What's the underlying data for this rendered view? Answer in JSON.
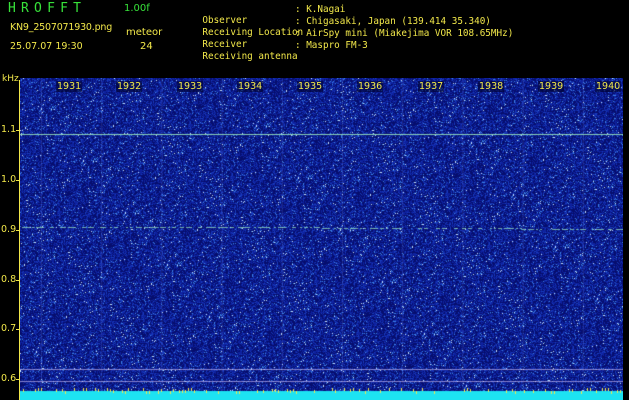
{
  "header": {
    "app_name": "HROFFT",
    "version": "1.00f",
    "filename": "KN9_2507071930.png",
    "unit_label": "meteor",
    "timestamp": "25.07.07 19:30",
    "count": "24",
    "info": [
      {
        "label": "Observer",
        "value": ": K.Nagai"
      },
      {
        "label": "Receiving Location",
        "value": ": Chigasaki, Japan (139.414 35.340)"
      },
      {
        "label": "Receiver",
        "value": ": AirSpy mini (Miakejima VOR 108.65MHz)"
      },
      {
        "label": "Receiving antenna",
        "value": ": Maspro FM-3"
      }
    ]
  },
  "spectrogram": {
    "y_unit": "kHz",
    "y_ticks": [
      "1.1",
      "1.0",
      "0.9",
      "0.8",
      "0.7",
      "0.6"
    ],
    "time_ticks": [
      "1931",
      "1932",
      "1933",
      "1934",
      "1935",
      "1936",
      "1937",
      "1938",
      "1939",
      "1940"
    ],
    "colors": {
      "background": "#0b1890",
      "axis_text": "#f2e84a",
      "title_text": "#37e23a",
      "carrier_line": "#9ff0c0",
      "base_band": "#1de3f2"
    }
  }
}
